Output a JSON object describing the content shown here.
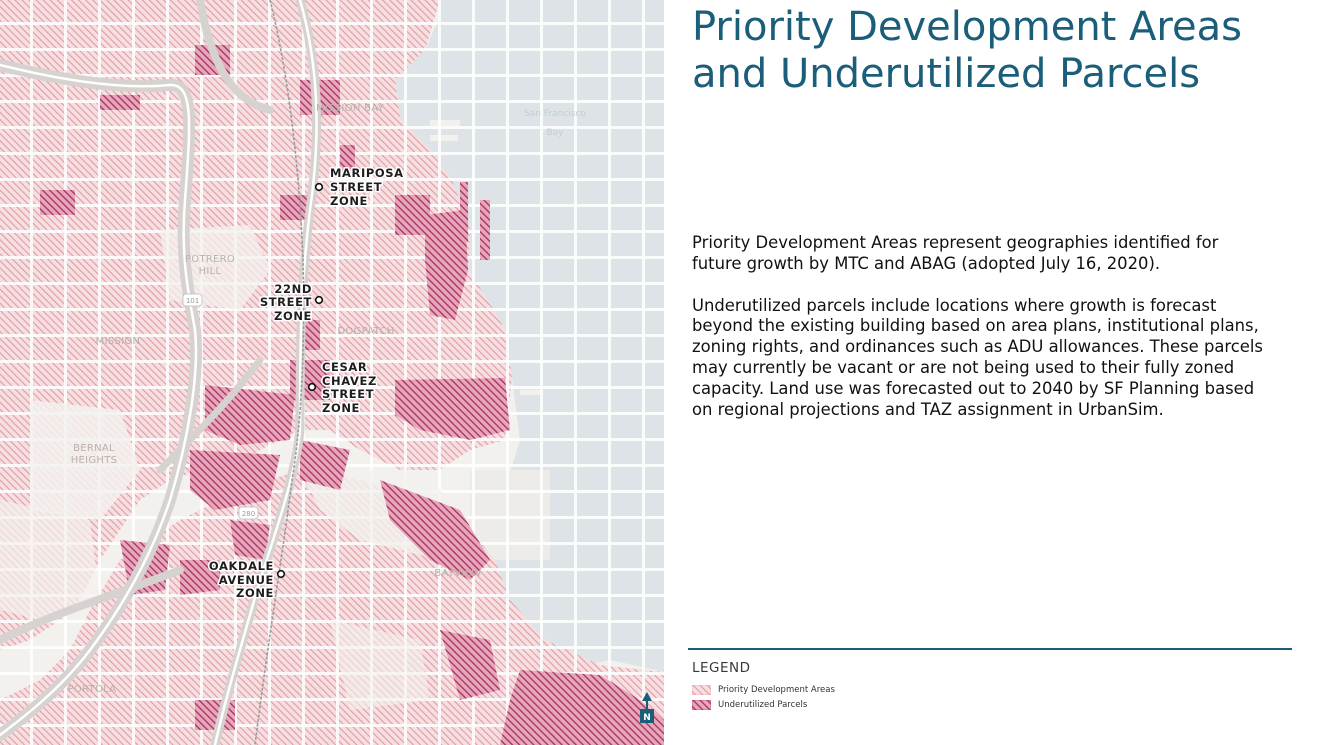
{
  "title": {
    "line1": "Priority Development Areas",
    "line2": "and Underutilized Parcels"
  },
  "description": {
    "p1": "Priority Development Areas represent geographies identified for future growth by MTC and ABAG (adopted July 16, 2020).",
    "p2": "Underutilized parcels include locations where growth is forecast beyond the existing building based on area plans, institutional plans, zoning rights, and ordinances such as ADU allowances. These parcels may currently be vacant or are not being used to their fully zoned capacity. Land use was forecasted out to 2040 by SF Planning based on regional projections and TAZ assignment in UrbanSim."
  },
  "legend": {
    "title": "LEGEND",
    "items": [
      {
        "label": "Priority Development Areas",
        "pattern": "pda"
      },
      {
        "label": "Underutilized Parcels",
        "pattern": "underutilized"
      }
    ]
  },
  "map": {
    "place_labels": {
      "mission_bay": "MISSION BAY",
      "potrero_1": "POTRERO",
      "potrero_2": "HILL",
      "mission": "MISSION",
      "dogpatch": "DOGPATCH",
      "bernal_1": "BERNAL",
      "bernal_2": "HEIGHTS",
      "bayview": "BAYVIEW",
      "portola": "PORTOLA"
    },
    "water_label": {
      "line1": "San Francisco",
      "line2": "Bay"
    },
    "highway_shields": {
      "us101": "101",
      "i280": "280"
    },
    "zones": {
      "mariposa": {
        "l1": "MARIPOSA",
        "l2": "STREET",
        "l3": "ZONE"
      },
      "twentysecond": {
        "l1": "22ND",
        "l2": "STREET",
        "l3": "ZONE"
      },
      "cesar": {
        "l1": "CESAR",
        "l2": "CHAVEZ",
        "l3": "STREET",
        "l4": "ZONE"
      },
      "oakdale": {
        "l1": "OAKDALE",
        "l2": "AVENUE",
        "l3": "ZONE"
      }
    },
    "north_arrow": "N",
    "colors": {
      "pda": "#e7a5ad",
      "underutilized": "#b03a69",
      "water": "#dde3e6",
      "land": "#f3f1ee",
      "road": "#ffffff",
      "accent": "#1a5e7a"
    }
  }
}
